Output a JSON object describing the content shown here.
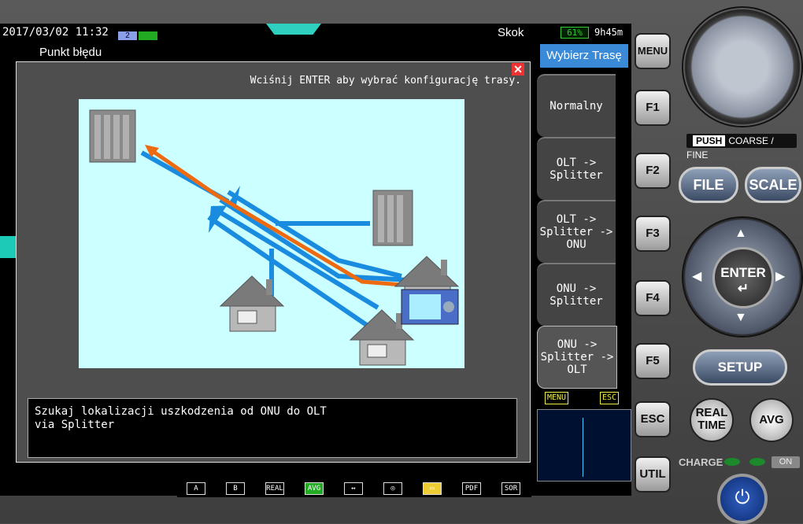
{
  "status": {
    "datetime": "2017/03/02 11:32",
    "tab2": "2",
    "mode": "Skok",
    "battery": "61%",
    "runtime": "9h45m"
  },
  "screen": {
    "title": "Punkt błędu",
    "hint": "Wciśnij ENTER aby wybrać konfigurację trasy.",
    "message_line1": "Szukaj lokalizacji uszkodzenia od ONU do OLT",
    "message_line2": "via Splitter"
  },
  "sidebar": {
    "header": "Wybierz Trasę",
    "items": [
      {
        "label": "Normalny"
      },
      {
        "label": "OLT -> Splitter"
      },
      {
        "label": "OLT -> Splitter -> ONU"
      },
      {
        "label": "ONU -> Splitter"
      },
      {
        "label": "ONU -> Splitter -> OLT"
      }
    ],
    "mini_menu": "MENU",
    "mini_esc": "ESC"
  },
  "bottom_icons": [
    "A",
    "B",
    "REAL",
    "AVG",
    "↔",
    "◎",
    "▭",
    "PDF",
    "SOR"
  ],
  "hardware": {
    "menu": "MENU",
    "f1": "F1",
    "f2": "F2",
    "f3": "F3",
    "f4": "F4",
    "f5": "F5",
    "esc": "ESC",
    "util": "UTIL",
    "push": "PUSH",
    "coarse_fine": "COARSE / FINE",
    "file": "FILE",
    "scale": "SCALE",
    "enter": "ENTER",
    "setup": "SETUP",
    "real_time": "REAL TIME",
    "avg": "AVG",
    "charge": "CHARGE",
    "on": "ON"
  },
  "colors": {
    "route_orange": "#ee6a10",
    "fiber_blue": "#1a8ce0",
    "diagram_bg": "#ccffff",
    "selected_header": "#3a8ad8"
  }
}
